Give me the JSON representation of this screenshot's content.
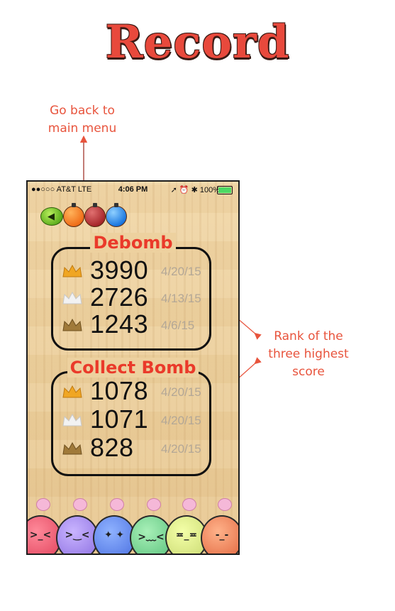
{
  "title": "Record",
  "annotations": {
    "back_line1": "Go back to",
    "back_line2": "main menu",
    "rank_line1": "Rank of the",
    "rank_line2": "three highest",
    "rank_line3": "score"
  },
  "status_bar": {
    "carrier": "●●○○○ AT&T  LTE",
    "time": "4:06 PM",
    "right": "➚ ⏰ ✱ 100%"
  },
  "colors": {
    "title": "#e8493c",
    "annotation": "#e8543d",
    "section_label": "#ea3a2a",
    "gold_crown": "#f0a623",
    "silver_crown": "#e8e8e8",
    "bronze_crown": "#a07a3a",
    "date_text": "#b3a796"
  },
  "icons": {
    "back": "back-arrow-icon",
    "bombs": [
      "orange-bomb-icon",
      "red-bomb-icon",
      "blue-bomb-icon"
    ]
  },
  "debomb": {
    "label": "Debomb",
    "rows": [
      {
        "rank": "gold",
        "score": "3990",
        "date": "4/20/15"
      },
      {
        "rank": "silver",
        "score": "2726",
        "date": "4/13/15"
      },
      {
        "rank": "bronze",
        "score": "1243",
        "date": "4/6/15"
      }
    ]
  },
  "collect_bomb": {
    "label": "Collect Bomb",
    "rows": [
      {
        "rank": "gold",
        "score": "1078",
        "date": "4/20/15"
      },
      {
        "rank": "silver",
        "score": "1071",
        "date": "4/20/15"
      },
      {
        "rank": "bronze",
        "score": "828",
        "date": "4/20/15"
      }
    ]
  }
}
